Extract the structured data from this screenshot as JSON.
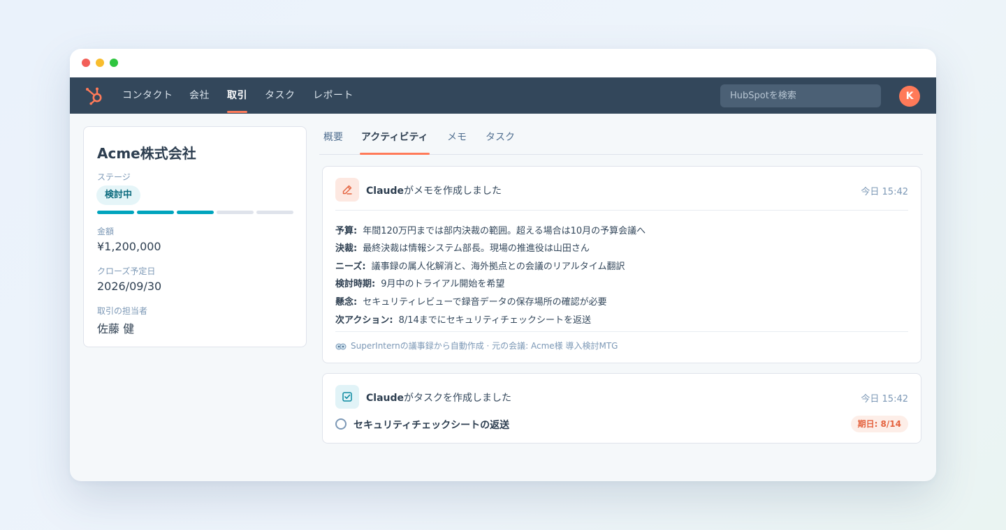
{
  "nav": {
    "items": [
      {
        "label": "コンタクト",
        "active": false
      },
      {
        "label": "会社",
        "active": false
      },
      {
        "label": "取引",
        "active": true
      },
      {
        "label": "タスク",
        "active": false
      },
      {
        "label": "レポート",
        "active": false
      }
    ],
    "search_placeholder": "HubSpotを検索",
    "avatar_initial": "K"
  },
  "deal": {
    "name": "Acme株式会社",
    "stage_label": "ステージ",
    "stage_value": "検討中",
    "stage_progress": {
      "completed": 3,
      "total": 5
    },
    "amount_label": "金額",
    "amount_value": "¥1,200,000",
    "close_date_label": "クローズ予定日",
    "close_date_value": "2026/09/30",
    "owner_label": "取引の担当者",
    "owner_value": "佐藤 健"
  },
  "tabs": [
    {
      "label": "概要",
      "active": false
    },
    {
      "label": "アクティビティ",
      "active": true
    },
    {
      "label": "メモ",
      "active": false
    },
    {
      "label": "タスク",
      "active": false
    }
  ],
  "activities": {
    "note": {
      "actor": "Claude",
      "action": "がメモを作成しました",
      "timestamp": "今日 15:42",
      "lines": [
        {
          "key": "予算:",
          "value": "年間120万円までは部内決裁の範囲。超える場合は10月の予算会議へ"
        },
        {
          "key": "決裁:",
          "value": "最終決裁は情報システム部長。現場の推進役は山田さん"
        },
        {
          "key": "ニーズ:",
          "value": "議事録の属人化解消と、海外拠点との会議のリアルタイム翻訳"
        },
        {
          "key": "検討時期:",
          "value": "9月中のトライアル開始を希望"
        },
        {
          "key": "懸念:",
          "value": "セキュリティレビューで録音データの保存場所の確認が必要"
        },
        {
          "key": "次アクション:",
          "value": "8/14までにセキュリティチェックシートを返送"
        }
      ],
      "source": "SuperInternの議事録から自動作成 · 元の会議: Acme様 導入検討MTG"
    },
    "task": {
      "actor": "Claude",
      "action": "がタスクを作成しました",
      "timestamp": "今日 15:42",
      "task_name": "セキュリティチェックシートの返送",
      "due": "期日: 8/14"
    }
  },
  "colors": {
    "nav_bg": "#33475b",
    "accent": "#ff7a59",
    "teal": "#00a4bd"
  }
}
